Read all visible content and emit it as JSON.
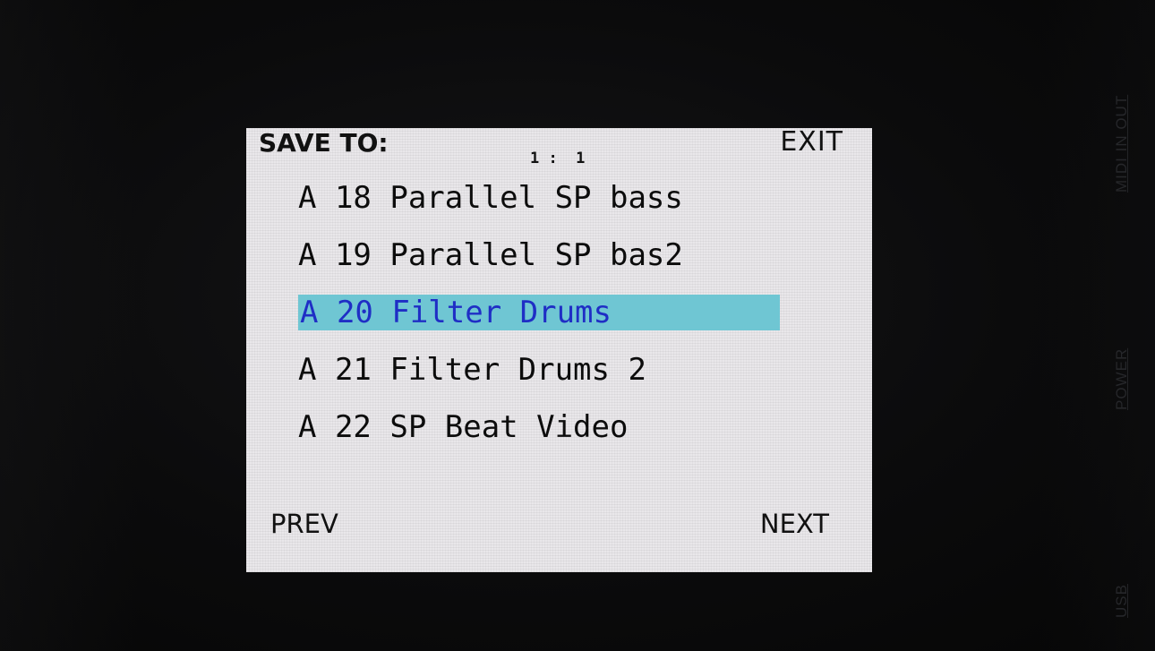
{
  "header": {
    "title": "SAVE TO:",
    "exit_label": "EXIT",
    "position": "1 :  1"
  },
  "presets": [
    {
      "label": "A 18 Parallel SP bass",
      "selected": false
    },
    {
      "label": "A 19 Parallel SP bas2",
      "selected": false
    },
    {
      "label": "A 20 Filter Drums",
      "selected": true
    },
    {
      "label": "A 21 Filter Drums 2",
      "selected": false
    },
    {
      "label": "A 22 SP Beat Video",
      "selected": false
    }
  ],
  "footer": {
    "prev_label": "PREV",
    "next_label": "NEXT"
  },
  "device_labels": {
    "midi": "MIDI IN  OUT",
    "power": "POWER",
    "usb": "USB"
  },
  "colors": {
    "screen_bg": "#e9e7ea",
    "highlight_bg": "#6fc6d3",
    "highlight_text": "#1f2ec5",
    "text": "#111111"
  }
}
